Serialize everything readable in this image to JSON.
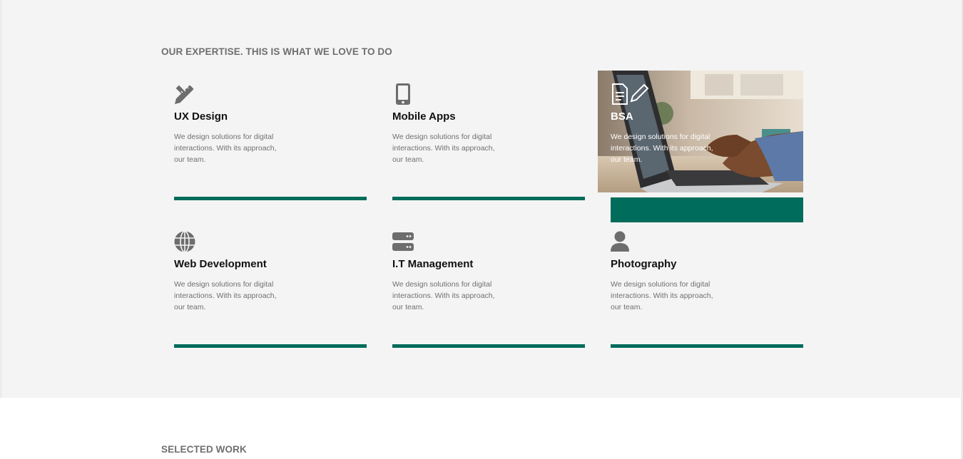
{
  "expertise": {
    "title": "OUR EXPERTISE. THIS IS WHAT WE LOVE TO DO",
    "accent_color": "#006c5b",
    "cards": [
      {
        "name": "UX Design",
        "icon": "pencil-ruler-icon",
        "description": "We design solutions for digital interactions. With its approach, our team."
      },
      {
        "name": "Mobile Apps",
        "icon": "mobile-phone-icon",
        "description": "We design solutions for digital interactions. With its approach, our team."
      },
      {
        "name": "BSA",
        "icon": "document-edit-icon",
        "description": "We design solutions for digital interactions. With its approach, our team."
      },
      {
        "name": "Web Development",
        "icon": "globe-icon",
        "description": "We design solutions for digital interactions. With its approach, our team."
      },
      {
        "name": "I.T Management",
        "icon": "server-icon",
        "description": "We design solutions for digital interactions. With its approach, our team."
      },
      {
        "name": "Photography",
        "icon": "user-icon",
        "description": "We design solutions for digital interactions. With its approach, our team."
      }
    ]
  },
  "selected_work": {
    "title": "SELECTED WORK"
  }
}
